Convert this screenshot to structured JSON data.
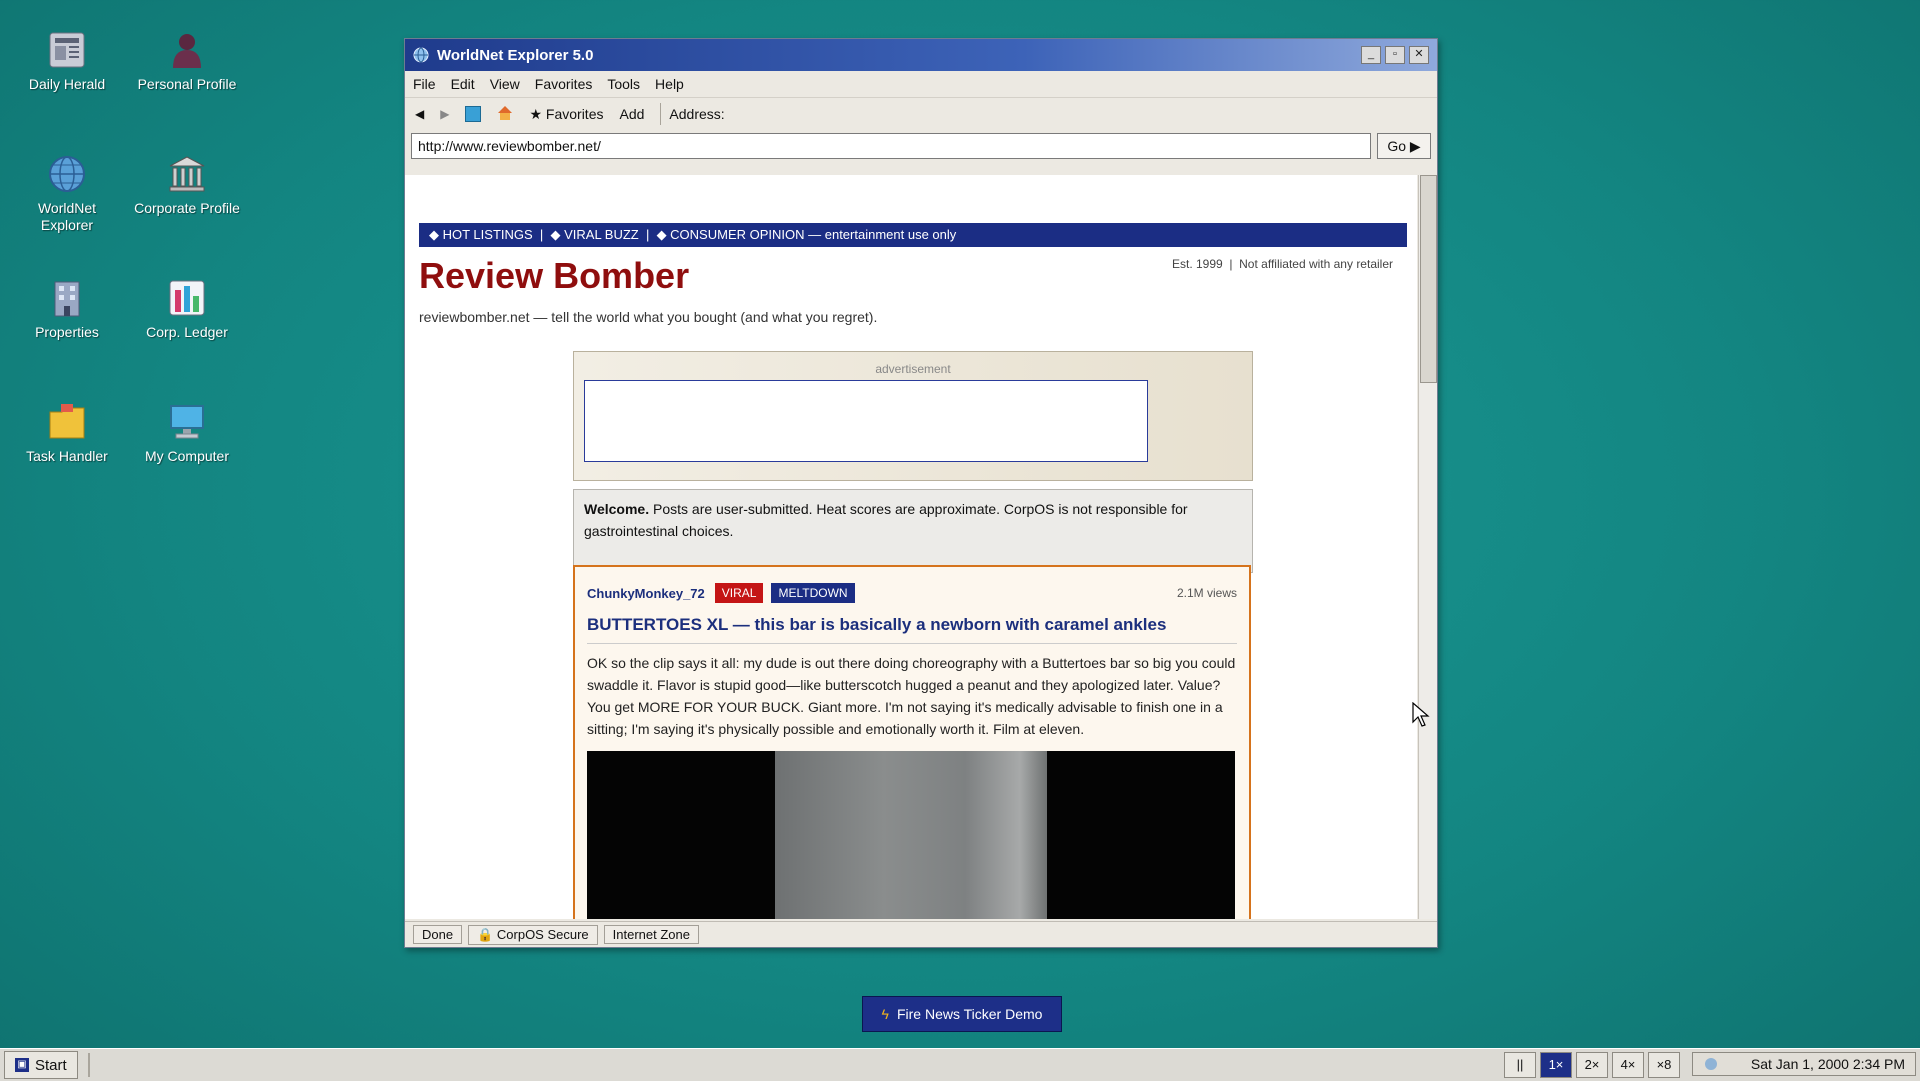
{
  "desktop": {
    "icons": [
      {
        "label": "Daily Herald",
        "icon": "newspaper-icon"
      },
      {
        "label": "Personal Profile",
        "icon": "person-icon"
      },
      {
        "label": "WorldNet Explorer",
        "icon": "globe-icon"
      },
      {
        "label": "Corporate Profile",
        "icon": "bank-icon"
      },
      {
        "label": "Properties",
        "icon": "building-icon"
      },
      {
        "label": "Corp. Ledger",
        "icon": "ledger-chart-icon"
      },
      {
        "label": "Task Handler",
        "icon": "folder-icon"
      },
      {
        "label": "My Computer",
        "icon": "computer-icon"
      }
    ]
  },
  "window": {
    "title": "WorldNet Explorer 5.0",
    "menu": [
      "File",
      "Edit",
      "View",
      "Favorites",
      "Tools",
      "Help"
    ],
    "toolbar": {
      "favorites": "★ Favorites",
      "add": "Add",
      "address_label": "Address:"
    },
    "address": "http://www.reviewbomber.net/",
    "go": "Go ▶",
    "status": {
      "done": "Done",
      "secure": "CorpOS Secure",
      "zone": "Internet Zone"
    }
  },
  "page": {
    "nav": "◆ HOT LISTINGS  |  ◆ VIRAL BUZZ  |  ◆ CONSUMER OPINION — entertainment use only",
    "meta": "Est. 1999  |  Not affiliated with any retailer",
    "title": "Review Bomber",
    "tagline": "reviewbomber.net — tell the world what you bought (and what you regret).",
    "ad_label": "advertisement",
    "welcome_bold": "Welcome.",
    "welcome_text": " Posts are user-submitted. Heat scores are approximate. CorpOS is not responsible for gastrointestinal choices.",
    "post": {
      "user": "ChunkyMonkey_72",
      "badge1": "VIRAL",
      "badge2": "MELTDOWN",
      "views": "2.1M views",
      "title": "BUTTERTOES XL — this bar is basically a newborn with caramel ankles",
      "body": "OK so the clip says it all: my dude is out there doing choreography with a Buttertoes bar so big you could swaddle it. Flavor is stupid good—like butterscotch hugged a peanut and they apologized later. Value? You get MORE FOR YOUR BUCK. Giant more. I'm not saying it's medically advisable to finish one in a sitting; I'm saying it's physically possible and emotionally worth it. Film at eleven."
    }
  },
  "ticker_button": "Fire News Ticker Demo",
  "taskbar": {
    "start": "Start",
    "speeds": [
      "||",
      "1×",
      "2×",
      "4×",
      "×8"
    ],
    "clock": "Sat Jan 1, 2000 2:34 PM"
  }
}
